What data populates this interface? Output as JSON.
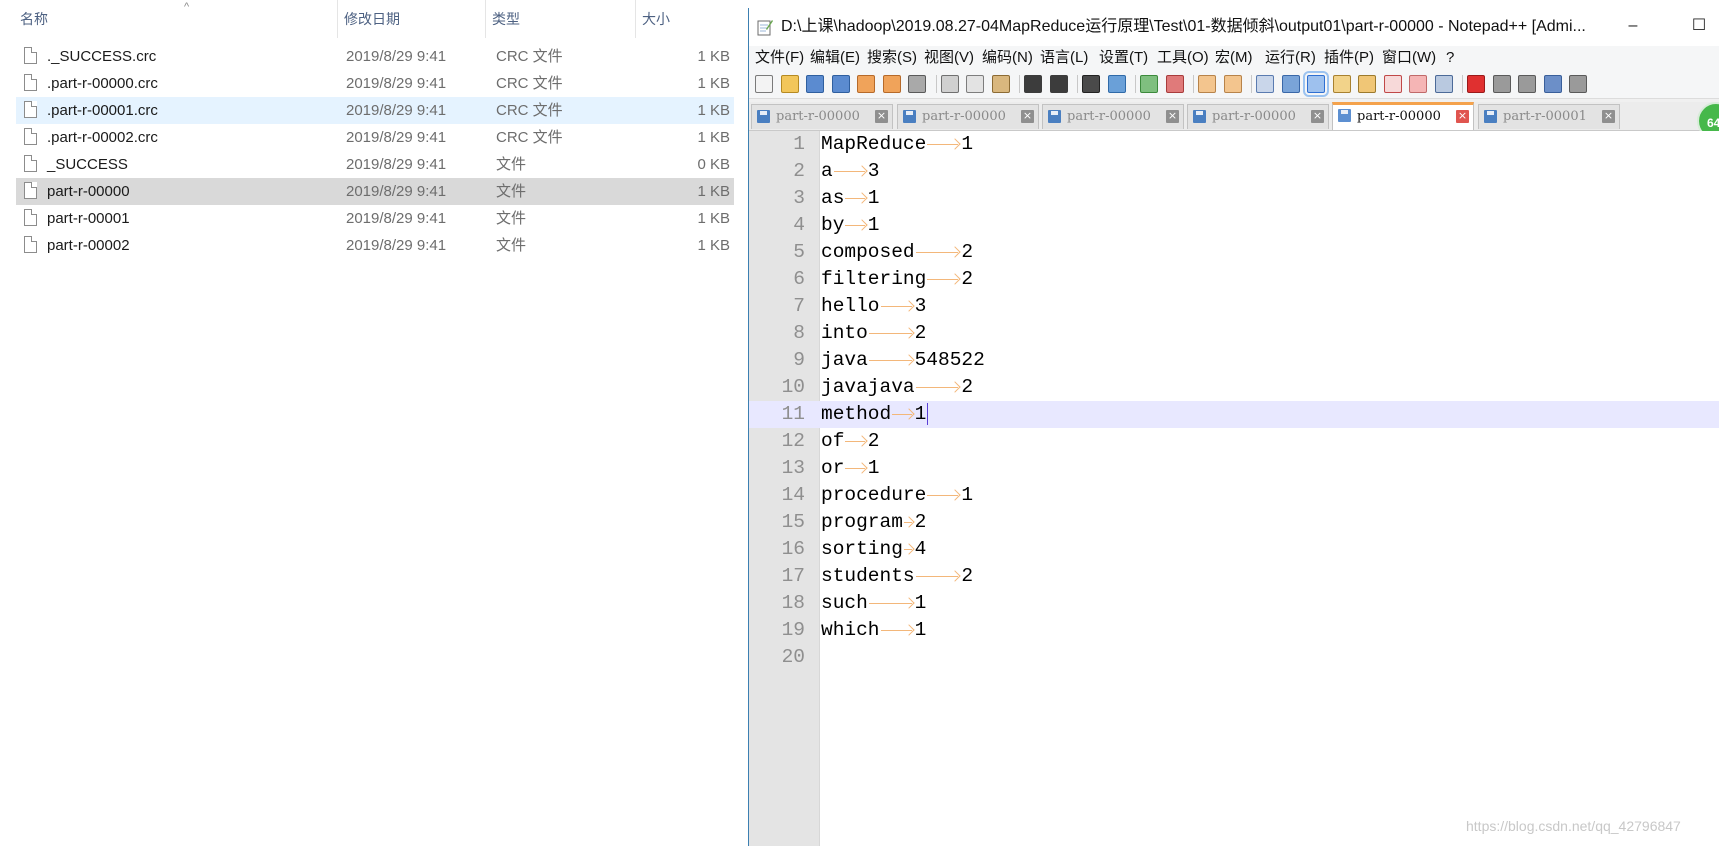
{
  "explorer": {
    "columns": {
      "name": "名称",
      "date": "修改日期",
      "type": "类型",
      "size": "大小"
    },
    "sort_indicator": "^",
    "files": [
      {
        "name": "._SUCCESS.crc",
        "date": "2019/8/29 9:41",
        "type": "CRC 文件",
        "size": "1 KB",
        "state": "normal"
      },
      {
        "name": ".part-r-00000.crc",
        "date": "2019/8/29 9:41",
        "type": "CRC 文件",
        "size": "1 KB",
        "state": "normal"
      },
      {
        "name": ".part-r-00001.crc",
        "date": "2019/8/29 9:41",
        "type": "CRC 文件",
        "size": "1 KB",
        "state": "hover"
      },
      {
        "name": ".part-r-00002.crc",
        "date": "2019/8/29 9:41",
        "type": "CRC 文件",
        "size": "1 KB",
        "state": "normal"
      },
      {
        "name": "_SUCCESS",
        "date": "2019/8/29 9:41",
        "type": "文件",
        "size": "0 KB",
        "state": "normal"
      },
      {
        "name": "part-r-00000",
        "date": "2019/8/29 9:41",
        "type": "文件",
        "size": "1 KB",
        "state": "selected"
      },
      {
        "name": "part-r-00001",
        "date": "2019/8/29 9:41",
        "type": "文件",
        "size": "1 KB",
        "state": "normal"
      },
      {
        "name": "part-r-00002",
        "date": "2019/8/29 9:41",
        "type": "文件",
        "size": "1 KB",
        "state": "normal"
      }
    ]
  },
  "npp": {
    "title": "D:\\上课\\hadoop\\2019.08.27-04MapReduce运行原理\\Test\\01-数据倾斜\\output01\\part-r-00000 - Notepad++ [Admi...",
    "window_buttons": {
      "minimize": "–",
      "maximize": "☐"
    },
    "menu": [
      "文件(F)",
      "编辑(E)",
      "搜索(S)",
      "视图(V)",
      "编码(N)",
      "语言(L)",
      "设置(T)",
      "工具(O)",
      "宏(M)",
      "运行(R)",
      "插件(P)",
      "窗口(W)",
      "?"
    ],
    "tabs": [
      {
        "label": "part-r-00000",
        "active": false
      },
      {
        "label": "part-r-00000",
        "active": false
      },
      {
        "label": "part-r-00000",
        "active": false
      },
      {
        "label": "part-r-00000",
        "active": false
      },
      {
        "label": "part-r-00000",
        "active": true
      },
      {
        "label": "part-r-00001",
        "active": false
      }
    ],
    "tab_close_glyph": "×",
    "badge": "64",
    "current_line": 11,
    "lines": [
      {
        "n": "1",
        "word": "MapReduce",
        "count": "1"
      },
      {
        "n": "2",
        "word": "a",
        "count": "3"
      },
      {
        "n": "3",
        "word": "as",
        "count": "1"
      },
      {
        "n": "4",
        "word": "by",
        "count": "1"
      },
      {
        "n": "5",
        "word": "composed",
        "count": "2"
      },
      {
        "n": "6",
        "word": "filtering",
        "count": "2"
      },
      {
        "n": "7",
        "word": "hello",
        "count": "3"
      },
      {
        "n": "8",
        "word": "into",
        "count": "2"
      },
      {
        "n": "9",
        "word": "java",
        "count": "548522"
      },
      {
        "n": "10",
        "word": "javajava",
        "count": "2"
      },
      {
        "n": "11",
        "word": "method",
        "count": "1"
      },
      {
        "n": "12",
        "word": "of",
        "count": "2"
      },
      {
        "n": "13",
        "word": "or",
        "count": "1"
      },
      {
        "n": "14",
        "word": "procedure",
        "count": "1"
      },
      {
        "n": "15",
        "word": "program",
        "count": "2"
      },
      {
        "n": "16",
        "word": "sorting",
        "count": "4"
      },
      {
        "n": "17",
        "word": "students",
        "count": "2"
      },
      {
        "n": "18",
        "word": "such",
        "count": "1"
      },
      {
        "n": "19",
        "word": "which",
        "count": "1"
      },
      {
        "n": "20",
        "word": "",
        "count": ""
      }
    ]
  },
  "watermark": "https://blog.csdn.net/qq_42796847",
  "colors": {
    "selected_row": "#d9d9d9",
    "hover_row": "#e5f3ff",
    "current_line": "#e8e8ff",
    "tab_arrow": "#f3b77a",
    "active_tab_accent": "#f4a24c",
    "close_active": "#e0554f",
    "badge": "#46b84a"
  }
}
